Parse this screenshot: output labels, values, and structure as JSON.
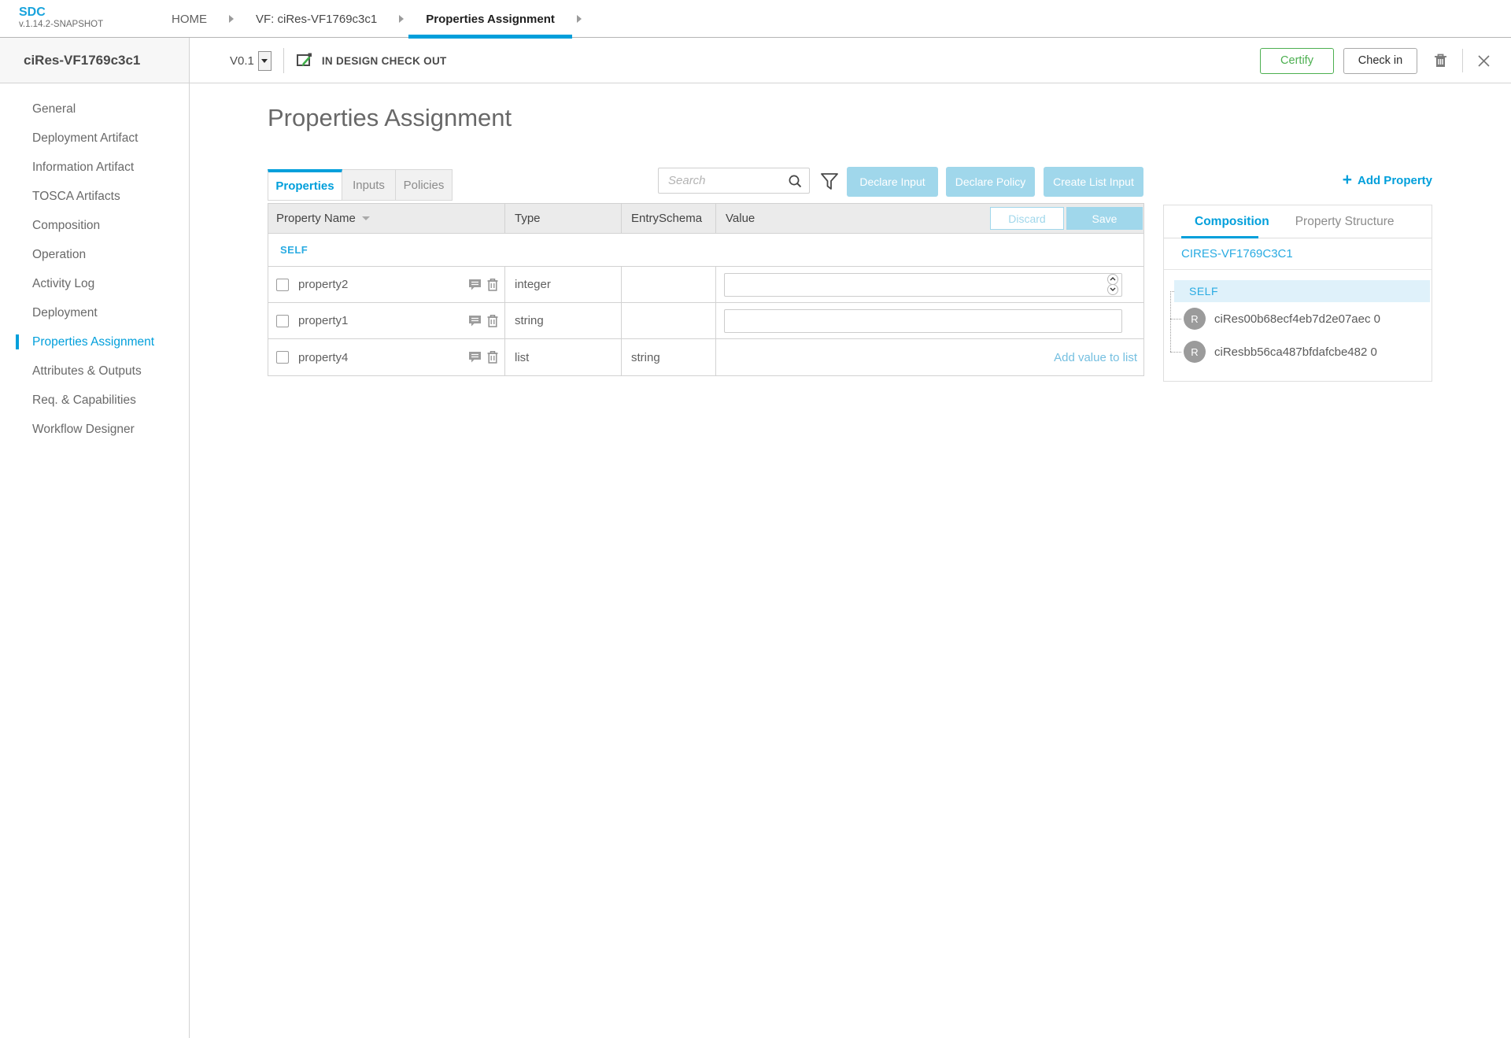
{
  "app": {
    "name": "SDC",
    "version": "v.1.14.2-SNAPSHOT"
  },
  "breadcrumbs": [
    {
      "label": "HOME"
    },
    {
      "label": "VF: ciRes-VF1769c3c1"
    },
    {
      "label": "Properties Assignment",
      "active": true
    }
  ],
  "sidebar": {
    "title": "ciRes-VF1769c3c1",
    "items": [
      {
        "label": "General"
      },
      {
        "label": "Deployment Artifact"
      },
      {
        "label": "Information Artifact"
      },
      {
        "label": "TOSCA Artifacts"
      },
      {
        "label": "Composition"
      },
      {
        "label": "Operation"
      },
      {
        "label": "Activity Log"
      },
      {
        "label": "Deployment"
      },
      {
        "label": "Properties Assignment",
        "active": true
      },
      {
        "label": "Attributes & Outputs"
      },
      {
        "label": "Req. & Capabilities"
      },
      {
        "label": "Workflow Designer"
      }
    ]
  },
  "toolbar": {
    "version": "V0.1",
    "status": "IN DESIGN CHECK OUT",
    "certify_label": "Certify",
    "checkin_label": "Check in"
  },
  "main": {
    "title": "Properties Assignment",
    "tabs": [
      {
        "label": "Properties",
        "active": true
      },
      {
        "label": "Inputs"
      },
      {
        "label": "Policies"
      }
    ],
    "search_placeholder": "Search",
    "actions": [
      {
        "label": "Declare Input"
      },
      {
        "label": "Declare Policy"
      },
      {
        "label": "Create List Input"
      }
    ],
    "add_property": {
      "plus": "+",
      "label": "Add Property"
    },
    "table": {
      "columns": [
        "Property Name",
        "Type",
        "EntrySchema",
        "Value"
      ],
      "discard_label": "Discard",
      "save_label": "Save",
      "group_label": "SELF",
      "rows": [
        {
          "name": "property2",
          "type": "integer",
          "entry_schema": "",
          "value": "",
          "value_kind": "number"
        },
        {
          "name": "property1",
          "type": "string",
          "entry_schema": "",
          "value": "",
          "value_kind": "text"
        },
        {
          "name": "property4",
          "type": "list",
          "entry_schema": "string",
          "link": "Add value to list",
          "value_kind": "link"
        }
      ]
    }
  },
  "right_panel": {
    "tabs": [
      {
        "label": "Composition",
        "active": true
      },
      {
        "label": "Property Structure"
      }
    ],
    "root": "CIRES-VF1769C3C1",
    "tree": {
      "self_label": "SELF",
      "children": [
        {
          "initial": "R",
          "label": "ciRes00b68ecf4eb7d2e07aec 0"
        },
        {
          "initial": "R",
          "label": "ciResbb56ca487bfdafcbe482 0"
        }
      ]
    }
  },
  "icons": [
    "sdc-logo",
    "chevron-right-icon",
    "dropdown-caret-icon",
    "checkout-pencil-icon",
    "trash-icon",
    "close-icon",
    "search-icon",
    "filter-funnel-icon",
    "sort-caret-icon",
    "comment-icon",
    "stepper-up-icon",
    "stepper-down-icon",
    "plus-icon",
    "avatar-initial"
  ],
  "colors": {
    "accent_blue": "#009fdb",
    "light_blue_button": "#a0d7eb",
    "link_blue": "#29abe2",
    "light_link": "#74bfe0",
    "certify_green": "#4caf50",
    "tree_highlight": "#dff1fa",
    "avatar_gray": "#9b9b9b",
    "header_gray": "#ebebeb"
  }
}
